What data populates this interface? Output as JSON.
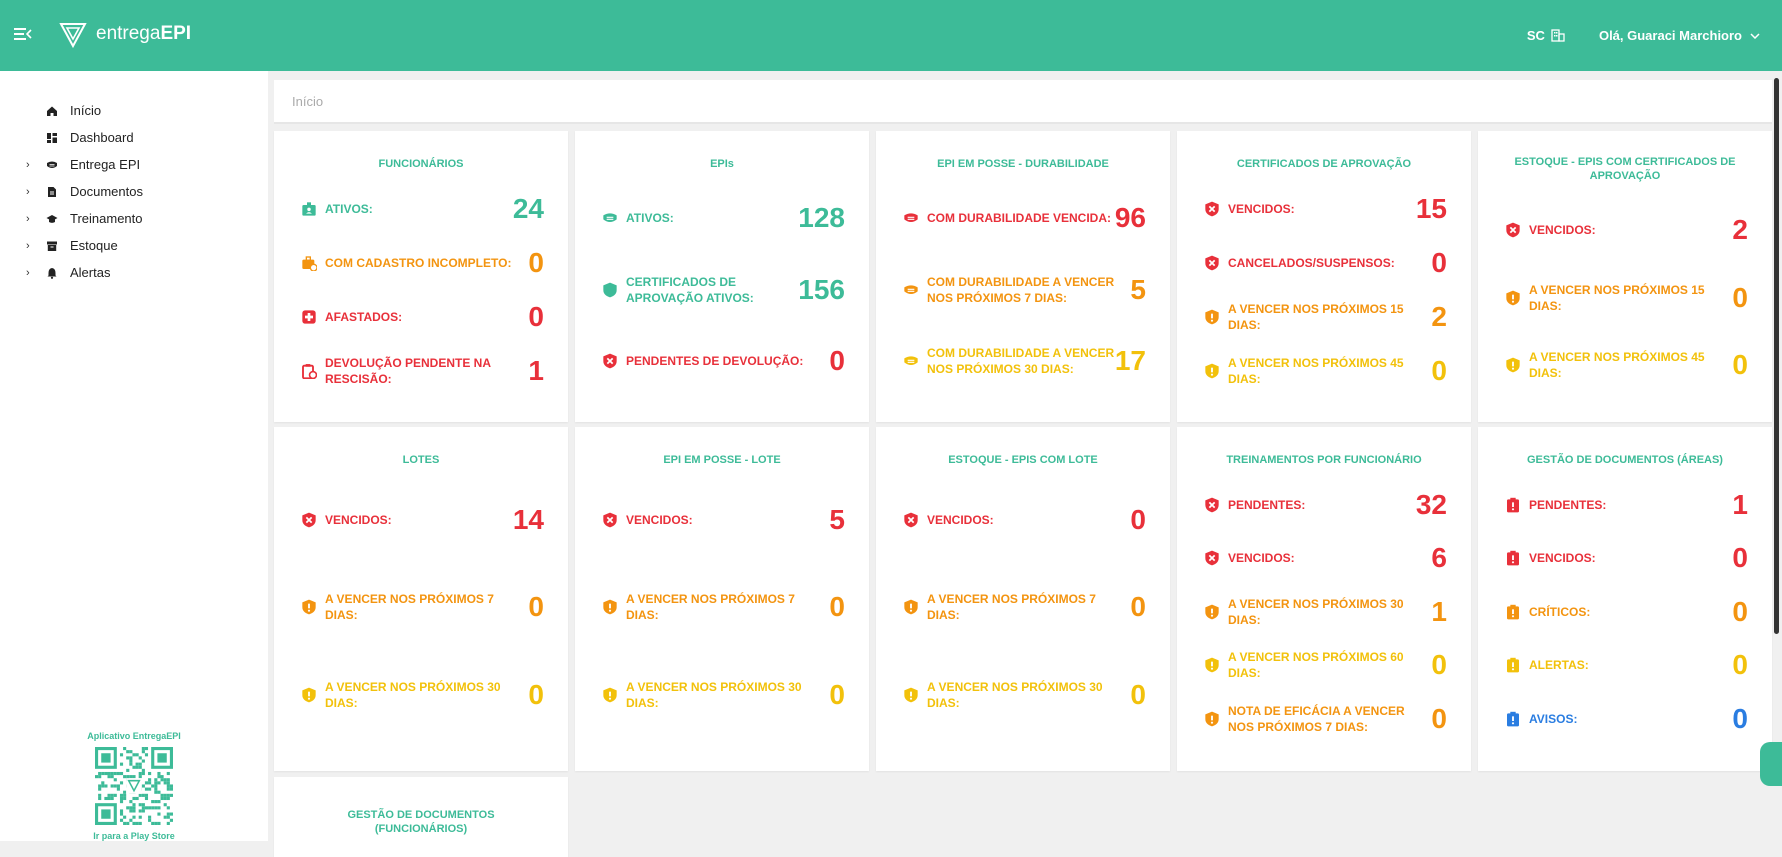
{
  "app": {
    "logo_text": "entrega",
    "logo_bold": "EPI",
    "org": "SC",
    "user_greeting": "Olá, Guaraci Marchioro"
  },
  "sidebar": {
    "items": [
      {
        "label": "Início",
        "icon": "home-icon"
      },
      {
        "label": "Dashboard",
        "icon": "dashboard-icon"
      },
      {
        "label": "Entrega EPI",
        "icon": "mask-icon",
        "expandable": true
      },
      {
        "label": "Documentos",
        "icon": "document-icon",
        "expandable": true
      },
      {
        "label": "Treinamento",
        "icon": "graduation-cap-icon",
        "expandable": true
      },
      {
        "label": "Estoque",
        "icon": "archive-icon",
        "expandable": true
      },
      {
        "label": "Alertas",
        "icon": "bell-icon",
        "expandable": true
      }
    ],
    "app_title": "Aplicativo EntregaEPI",
    "play_link": "Ir para a Play Store"
  },
  "breadcrumb": "Início",
  "colors": {
    "green": "#3dbb98",
    "red": "#e8303a",
    "orange": "#f39410",
    "yellow": "#f2c10b",
    "blue": "#2a7de1"
  },
  "cards": [
    {
      "title": "FUNCIONÁRIOS",
      "rows": [
        {
          "label": "ATIVOS:",
          "value": "24",
          "color": "green",
          "icon": "id-badge-icon"
        },
        {
          "label": "COM CADASTRO INCOMPLETO:",
          "value": "0",
          "color": "orange",
          "icon": "briefcase-clock-icon"
        },
        {
          "label": "AFASTADOS:",
          "value": "0",
          "color": "red",
          "icon": "medical-cross-icon"
        },
        {
          "label": "DEVOLUÇÃO PENDENTE NA RESCISÃO:",
          "value": "1",
          "color": "red",
          "icon": "clipboard-clock-icon"
        }
      ]
    },
    {
      "title": "EPIs",
      "rows": [
        {
          "label": "ATIVOS:",
          "value": "128",
          "color": "green",
          "icon": "mask-icon"
        },
        {
          "label": "CERTIFICADOS DE APROVAÇÃO ATIVOS:",
          "value": "156",
          "color": "green",
          "icon": "shield-icon"
        },
        {
          "label": "PENDENTES DE DEVOLUÇÃO:",
          "value": "0",
          "color": "red",
          "icon": "shield-x-icon"
        }
      ]
    },
    {
      "title": "EPI EM POSSE - DURABILIDADE",
      "rows": [
        {
          "label": "COM DURABILIDADE VENCIDA:",
          "value": "96",
          "color": "red",
          "icon": "mask-icon"
        },
        {
          "label": "COM DURABILIDADE A VENCER NOS PRÓXIMOS 7 DIAS:",
          "value": "5",
          "color": "orange",
          "icon": "mask-icon"
        },
        {
          "label": "COM DURABILIDADE A VENCER NOS PRÓXIMOS 30 DIAS:",
          "value": "17",
          "color": "yellow",
          "icon": "mask-icon"
        }
      ]
    },
    {
      "title": "CERTIFICADOS DE APROVAÇÃO",
      "rows": [
        {
          "label": "VENCIDOS:",
          "value": "15",
          "color": "red",
          "icon": "shield-x-icon"
        },
        {
          "label": "CANCELADOS/SUSPENSOS:",
          "value": "0",
          "color": "red",
          "icon": "shield-x-icon"
        },
        {
          "label": "A VENCER NOS PRÓXIMOS 15 DIAS:",
          "value": "2",
          "color": "orange",
          "icon": "shield-alert-icon"
        },
        {
          "label": "A VENCER NOS PRÓXIMOS 45 DIAS:",
          "value": "0",
          "color": "yellow",
          "icon": "shield-alert-icon"
        }
      ]
    },
    {
      "title": "ESTOQUE - EPIS COM CERTIFICADOS DE APROVAÇÃO",
      "rows": [
        {
          "label": "VENCIDOS:",
          "value": "2",
          "color": "red",
          "icon": "shield-x-icon"
        },
        {
          "label": "A VENCER NOS PRÓXIMOS 15 DIAS:",
          "value": "0",
          "color": "orange",
          "icon": "shield-alert-icon"
        },
        {
          "label": "A VENCER NOS PRÓXIMOS 45 DIAS:",
          "value": "0",
          "color": "yellow",
          "icon": "shield-alert-icon"
        }
      ]
    },
    {
      "title": "LOTES",
      "rows": [
        {
          "label": "VENCIDOS:",
          "value": "14",
          "color": "red",
          "icon": "shield-x-icon"
        },
        {
          "label": "A VENCER NOS PRÓXIMOS 7 DIAS:",
          "value": "0",
          "color": "orange",
          "icon": "shield-alert-icon"
        },
        {
          "label": "A VENCER NOS PRÓXIMOS 30 DIAS:",
          "value": "0",
          "color": "yellow",
          "icon": "shield-alert-icon"
        }
      ]
    },
    {
      "title": "EPI EM POSSE - LOTE",
      "rows": [
        {
          "label": "VENCIDOS:",
          "value": "5",
          "color": "red",
          "icon": "shield-x-icon"
        },
        {
          "label": "A VENCER NOS PRÓXIMOS 7 DIAS:",
          "value": "0",
          "color": "orange",
          "icon": "shield-alert-icon"
        },
        {
          "label": "A VENCER NOS PRÓXIMOS 30 DIAS:",
          "value": "0",
          "color": "yellow",
          "icon": "shield-alert-icon"
        }
      ]
    },
    {
      "title": "ESTOQUE - EPIS COM LOTE",
      "rows": [
        {
          "label": "VENCIDOS:",
          "value": "0",
          "color": "red",
          "icon": "shield-x-icon"
        },
        {
          "label": "A VENCER NOS PRÓXIMOS 7 DIAS:",
          "value": "0",
          "color": "orange",
          "icon": "shield-alert-icon"
        },
        {
          "label": "A VENCER NOS PRÓXIMOS 30 DIAS:",
          "value": "0",
          "color": "yellow",
          "icon": "shield-alert-icon"
        }
      ]
    },
    {
      "title": "TREINAMENTOS POR FUNCIONÁRIO",
      "rows": [
        {
          "label": "PENDENTES:",
          "value": "32",
          "color": "red",
          "icon": "shield-x-icon"
        },
        {
          "label": "VENCIDOS:",
          "value": "6",
          "color": "red",
          "icon": "shield-x-icon"
        },
        {
          "label": "A VENCER NOS PRÓXIMOS 30 DIAS:",
          "value": "1",
          "color": "orange",
          "icon": "shield-alert-icon"
        },
        {
          "label": "A VENCER NOS PRÓXIMOS 60 DIAS:",
          "value": "0",
          "color": "yellow",
          "icon": "shield-alert-icon"
        },
        {
          "label": "NOTA DE EFICÁCIA A VENCER NOS PRÓXIMOS 7 DIAS:",
          "value": "0",
          "color": "orange",
          "icon": "shield-alert-icon"
        }
      ]
    },
    {
      "title": "GESTÃO DE DOCUMENTOS (ÁREAS)",
      "rows": [
        {
          "label": "PENDENTES:",
          "value": "1",
          "color": "red",
          "icon": "clipboard-alert-icon"
        },
        {
          "label": "VENCIDOS:",
          "value": "0",
          "color": "red",
          "icon": "clipboard-alert-icon"
        },
        {
          "label": "CRÍTICOS:",
          "value": "0",
          "color": "orange",
          "icon": "clipboard-alert-icon"
        },
        {
          "label": "ALERTAS:",
          "value": "0",
          "color": "yellow",
          "icon": "clipboard-alert-icon"
        },
        {
          "label": "AVISOS:",
          "value": "0",
          "color": "blue",
          "icon": "clipboard-alert-icon"
        }
      ]
    },
    {
      "title": "GESTÃO DE DOCUMENTOS (FUNCIONÁRIOS)",
      "rows": []
    }
  ]
}
